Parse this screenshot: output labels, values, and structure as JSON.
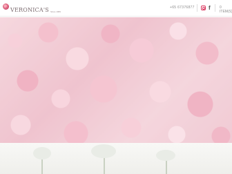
{
  "header": {
    "logo_text": "VERONICA'S",
    "logo_tagline": "Since 1983",
    "phone": "+65 67376877",
    "instagram_icon": "instagram-icon",
    "facebook_icon": "facebook-icon",
    "facebook_glyph": "f",
    "cart_label": "0 ITEM(S)",
    "cart_icon": "shopping-bag-icon"
  },
  "hero": {
    "image": "pink-roses-floral-arrangement"
  },
  "lower": {
    "image": "white-flowers-bouquet"
  },
  "colors": {
    "accent_pink": "#d9365e",
    "hero_pink": "#e9a2b4"
  }
}
